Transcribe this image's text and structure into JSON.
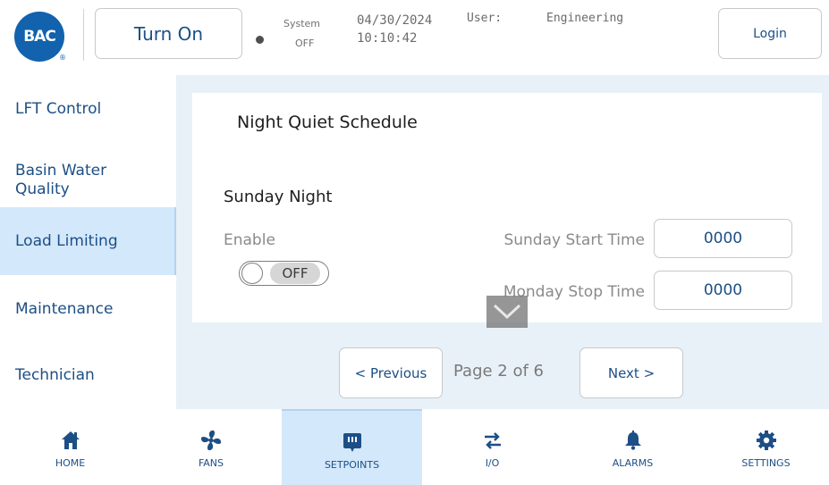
{
  "header": {
    "logo_text": "BAC",
    "logo_reg": "®",
    "turn_on_label": "Turn On",
    "system_label": "System",
    "system_state": "OFF",
    "date": "04/30/2024",
    "time": "10:10:42",
    "user_label": "User:",
    "user_value": "Engineering",
    "login_label": "Login"
  },
  "sidebar": {
    "items": [
      {
        "label": "LFT Control",
        "active": false
      },
      {
        "label": "Basin Water Quality",
        "active": false
      },
      {
        "label": "Load Limiting",
        "active": true
      },
      {
        "label": "Maintenance",
        "active": false
      },
      {
        "label": "Technician",
        "active": false
      }
    ]
  },
  "main": {
    "panel_title": "Night Quiet Schedule",
    "section_title": "Sunday Night",
    "enable_label": "Enable",
    "toggle_state": "OFF",
    "fields": [
      {
        "label": "Sunday Start Time",
        "value": "0000"
      },
      {
        "label": "Monday Stop Time",
        "value": "0000"
      }
    ],
    "pager": {
      "previous_label": "< Previous",
      "page_text": "Page 2 of 6",
      "next_label": "Next >"
    }
  },
  "bottom_nav": {
    "items": [
      {
        "label": "HOME",
        "icon": "home-icon",
        "active": false
      },
      {
        "label": "FANS",
        "icon": "fan-icon",
        "active": false
      },
      {
        "label": "SETPOINTS",
        "icon": "setpoints-icon",
        "active": true
      },
      {
        "label": "I/O",
        "icon": "io-arrows-icon",
        "active": false
      },
      {
        "label": "ALARMS",
        "icon": "bell-icon",
        "active": false
      },
      {
        "label": "SETTINGS",
        "icon": "gear-icon",
        "active": false
      }
    ]
  },
  "colors": {
    "brand_blue": "#1262ad",
    "text_blue": "#1c4f86",
    "active_bg": "#d4e8fb",
    "content_bg": "#e8f1f7"
  }
}
